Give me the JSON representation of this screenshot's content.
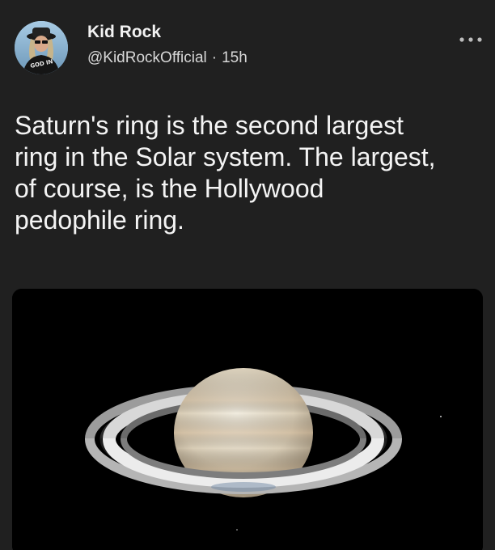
{
  "post": {
    "author": {
      "display_name": "Kid Rock",
      "handle": "@KidRockOfficial",
      "time_ago": "15h",
      "separator": "·",
      "avatar_icon": "profile-photo"
    },
    "more_icon": "ellipsis-icon",
    "body_text": "Saturn's ring is the second largest\nring in the Solar system. The largest,\nof course, is the Hollywood\npedophile ring.",
    "media": {
      "subject": "saturn-photo"
    }
  },
  "colors": {
    "background": "#202020",
    "text_primary": "#f4f4f4",
    "text_secondary": "#d8d8d8",
    "media_background": "#000000"
  }
}
